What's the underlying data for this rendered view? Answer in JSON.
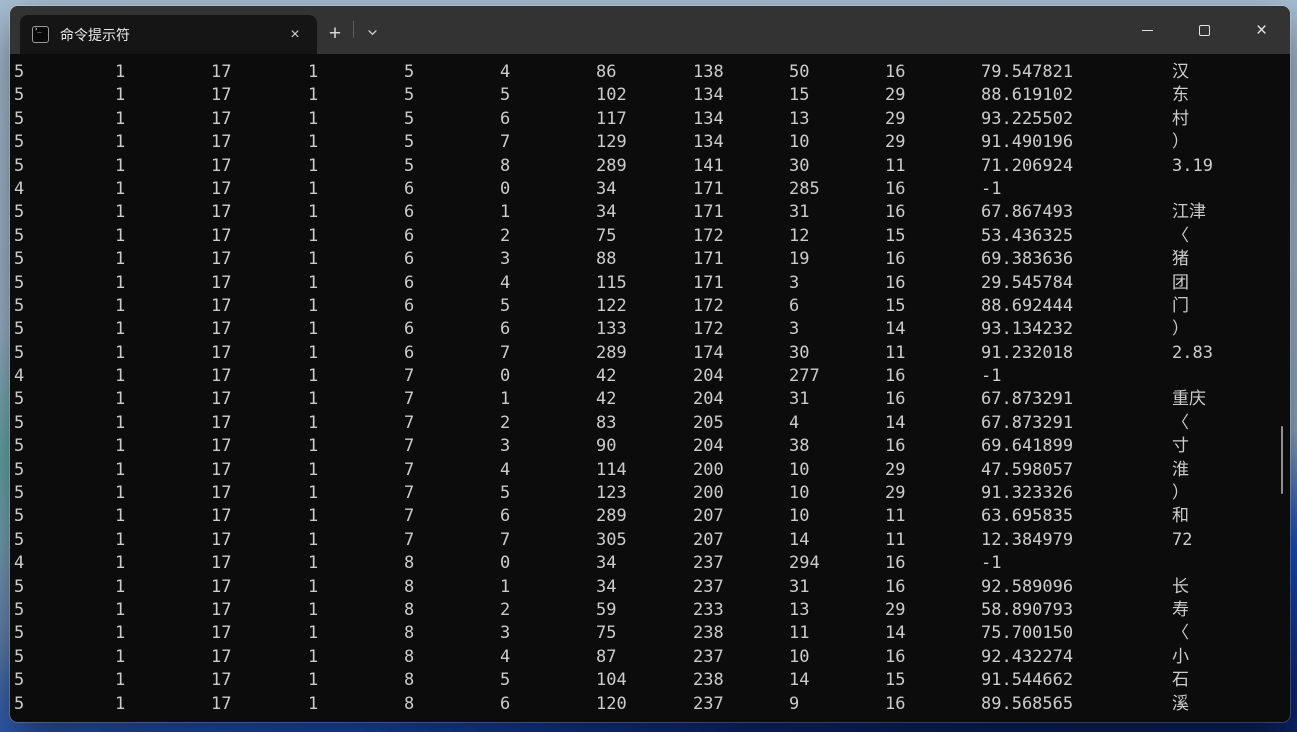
{
  "window": {
    "titlebar": {
      "tab": {
        "title": "命令提示符",
        "close_glyph": "×"
      },
      "new_tab_glyph": "+",
      "icons": {
        "tab_app_icon": "cmd-prompt-icon",
        "dropdown": "chevron-down-icon",
        "minimize": "minimize-icon",
        "maximize": "maximize-icon",
        "close": "close-icon"
      },
      "controls_close_glyph": "×"
    }
  },
  "terminal": {
    "colors": {
      "background": "#0c0c0c",
      "text": "#cccccc",
      "titlebar": "#333333",
      "tab": "#151515",
      "wallpaper_accent": "#1a4fc0"
    },
    "rows": [
      [
        "5",
        "1",
        "17",
        "1",
        "5",
        "4",
        "86",
        "138",
        "50",
        "16",
        "79.547821",
        "汉"
      ],
      [
        "5",
        "1",
        "17",
        "1",
        "5",
        "5",
        "102",
        "134",
        "15",
        "29",
        "88.619102",
        "东"
      ],
      [
        "5",
        "1",
        "17",
        "1",
        "5",
        "6",
        "117",
        "134",
        "13",
        "29",
        "93.225502",
        "村"
      ],
      [
        "5",
        "1",
        "17",
        "1",
        "5",
        "7",
        "129",
        "134",
        "10",
        "29",
        "91.490196",
        "）"
      ],
      [
        "5",
        "1",
        "17",
        "1",
        "5",
        "8",
        "289",
        "141",
        "30",
        "11",
        "71.206924",
        "3.19"
      ],
      [
        "4",
        "1",
        "17",
        "1",
        "6",
        "0",
        "34",
        "171",
        "285",
        "16",
        "-1",
        ""
      ],
      [
        "5",
        "1",
        "17",
        "1",
        "6",
        "1",
        "34",
        "171",
        "31",
        "16",
        "67.867493",
        "江津"
      ],
      [
        "5",
        "1",
        "17",
        "1",
        "6",
        "2",
        "75",
        "172",
        "12",
        "15",
        "53.436325",
        "〈"
      ],
      [
        "5",
        "1",
        "17",
        "1",
        "6",
        "3",
        "88",
        "171",
        "19",
        "16",
        "69.383636",
        "猪"
      ],
      [
        "5",
        "1",
        "17",
        "1",
        "6",
        "4",
        "115",
        "171",
        "3",
        "16",
        "29.545784",
        "团"
      ],
      [
        "5",
        "1",
        "17",
        "1",
        "6",
        "5",
        "122",
        "172",
        "6",
        "15",
        "88.692444",
        "门"
      ],
      [
        "5",
        "1",
        "17",
        "1",
        "6",
        "6",
        "133",
        "172",
        "3",
        "14",
        "93.134232",
        "）"
      ],
      [
        "5",
        "1",
        "17",
        "1",
        "6",
        "7",
        "289",
        "174",
        "30",
        "11",
        "91.232018",
        "2.83"
      ],
      [
        "4",
        "1",
        "17",
        "1",
        "7",
        "0",
        "42",
        "204",
        "277",
        "16",
        "-1",
        ""
      ],
      [
        "5",
        "1",
        "17",
        "1",
        "7",
        "1",
        "42",
        "204",
        "31",
        "16",
        "67.873291",
        "重庆"
      ],
      [
        "5",
        "1",
        "17",
        "1",
        "7",
        "2",
        "83",
        "205",
        "4",
        "14",
        "67.873291",
        "〈"
      ],
      [
        "5",
        "1",
        "17",
        "1",
        "7",
        "3",
        "90",
        "204",
        "38",
        "16",
        "69.641899",
        "寸"
      ],
      [
        "5",
        "1",
        "17",
        "1",
        "7",
        "4",
        "114",
        "200",
        "10",
        "29",
        "47.598057",
        "淮"
      ],
      [
        "5",
        "1",
        "17",
        "1",
        "7",
        "5",
        "123",
        "200",
        "10",
        "29",
        "91.323326",
        "）"
      ],
      [
        "5",
        "1",
        "17",
        "1",
        "7",
        "6",
        "289",
        "207",
        "10",
        "11",
        "63.695835",
        "和"
      ],
      [
        "5",
        "1",
        "17",
        "1",
        "7",
        "7",
        "305",
        "207",
        "14",
        "11",
        "12.384979",
        "72"
      ],
      [
        "4",
        "1",
        "17",
        "1",
        "8",
        "0",
        "34",
        "237",
        "294",
        "16",
        "-1",
        ""
      ],
      [
        "5",
        "1",
        "17",
        "1",
        "8",
        "1",
        "34",
        "237",
        "31",
        "16",
        "92.589096",
        "长"
      ],
      [
        "5",
        "1",
        "17",
        "1",
        "8",
        "2",
        "59",
        "233",
        "13",
        "29",
        "58.890793",
        "寿"
      ],
      [
        "5",
        "1",
        "17",
        "1",
        "8",
        "3",
        "75",
        "238",
        "11",
        "14",
        "75.700150",
        "〈"
      ],
      [
        "5",
        "1",
        "17",
        "1",
        "8",
        "4",
        "87",
        "237",
        "10",
        "16",
        "92.432274",
        "小"
      ],
      [
        "5",
        "1",
        "17",
        "1",
        "8",
        "5",
        "104",
        "238",
        "14",
        "15",
        "91.544662",
        "石"
      ],
      [
        "5",
        "1",
        "17",
        "1",
        "8",
        "6",
        "120",
        "237",
        "9",
        "16",
        "89.568565",
        "溪"
      ]
    ]
  }
}
